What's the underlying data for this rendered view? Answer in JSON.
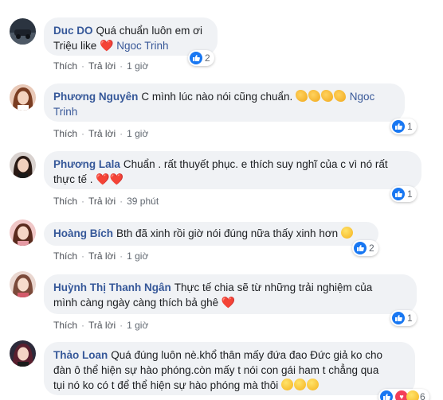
{
  "labels": {
    "like": "Thích",
    "reply": "Trả lời",
    "dot": "·"
  },
  "comments": [
    {
      "author": "Duc DO",
      "text_a": "Quá chuẩn luôn em ơi",
      "text_b": "Triệu like",
      "heart": "❤️",
      "tag": "Ngoc Trinh",
      "time": "1 giờ",
      "reactions": "2"
    },
    {
      "author": "Phương Nguyên",
      "text_a": "C mình lúc nào nói cũng chuẩn.",
      "tag_a": "Ngoc",
      "tag_b": "Trinh",
      "time": "1 giờ",
      "reactions": "1"
    },
    {
      "author": "Phương Lala",
      "text_a": "Chuẩn . rất thuyết phục. e thích suy nghĩ của c vì nó rất",
      "text_b": "thực tế .",
      "hearts": "❤️❤️",
      "time": "39 phút",
      "reactions": "1"
    },
    {
      "author": "Hoàng Bích",
      "text_a": "Bth đã xinh rồi giờ nói đúng nữa thấy xinh hơn",
      "time": "1 giờ",
      "reactions": "2"
    },
    {
      "author": "Huỳnh Thị Thanh Ngân",
      "text_a": "Thực tế chia sẽ từ những trải nghiệm của",
      "text_b": "mình càng ngày càng thích bả ghê",
      "heart": "❤️",
      "time": "1 giờ",
      "reactions": "1"
    },
    {
      "author": "Thảo Loan",
      "text_a": "Quá đúng luôn nè.khổ thân mấy đứa đao Đức giả ko cho",
      "text_b": "đàn ô thể hiện sự hào phóng.còn mấy t nói con gái ham t chẳng qua",
      "text_c": "tụi nó ko có t để thể hiện sự hào phóng mà thôi",
      "reactions": "6"
    }
  ],
  "colors": {
    "author": "#365899",
    "bubble": "#f0f2f5",
    "like": "#1877f2",
    "heart": "#f33e58"
  },
  "icons": [
    "like-icon",
    "heart-icon",
    "laugh-icon",
    "clap-icon",
    "kiss-icon"
  ]
}
